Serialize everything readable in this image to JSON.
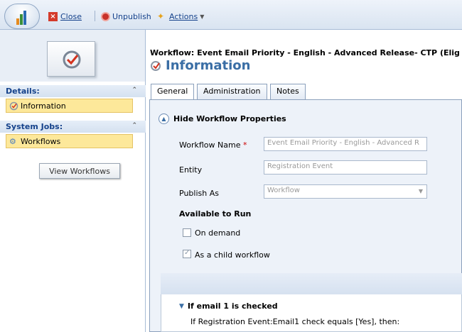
{
  "toolbar": {
    "close_label": "Close",
    "unpublish_label": "Unpublish",
    "actions_label": "Actions"
  },
  "header": {
    "workflow_title": "Workflow: Event Email Priority - English - Advanced Release- CTP (Elig",
    "section_title": "Information"
  },
  "nav": {
    "details_heading": "Details:",
    "details_item": "Information",
    "system_jobs_heading": "System Jobs:",
    "system_jobs_item": "Workflows",
    "view_button": "View Workflows"
  },
  "tabs": [
    "General",
    "Administration",
    "Notes"
  ],
  "form": {
    "hide_props_label": "Hide Workflow Properties",
    "workflow_name_label": "Workflow Name",
    "required_mark": "*",
    "workflow_name_value": "Event Email Priority - English - Advanced R",
    "entity_label": "Entity",
    "entity_value": "Registration Event",
    "publish_as_label": "Publish As",
    "publish_as_value": "Workflow",
    "available_heading": "Available to Run",
    "on_demand_label": "On demand",
    "on_demand_checked": false,
    "child_workflow_label": "As a child workflow",
    "child_workflow_checked": true
  },
  "steps": {
    "if_heading": "If email 1 is checked",
    "condition_text": "If Registration Event:Email1 check equals [Yes], then:"
  },
  "colors": {
    "accent": "#3a6ea5",
    "nav_selected": "#fde89a",
    "link": "#15428b"
  }
}
